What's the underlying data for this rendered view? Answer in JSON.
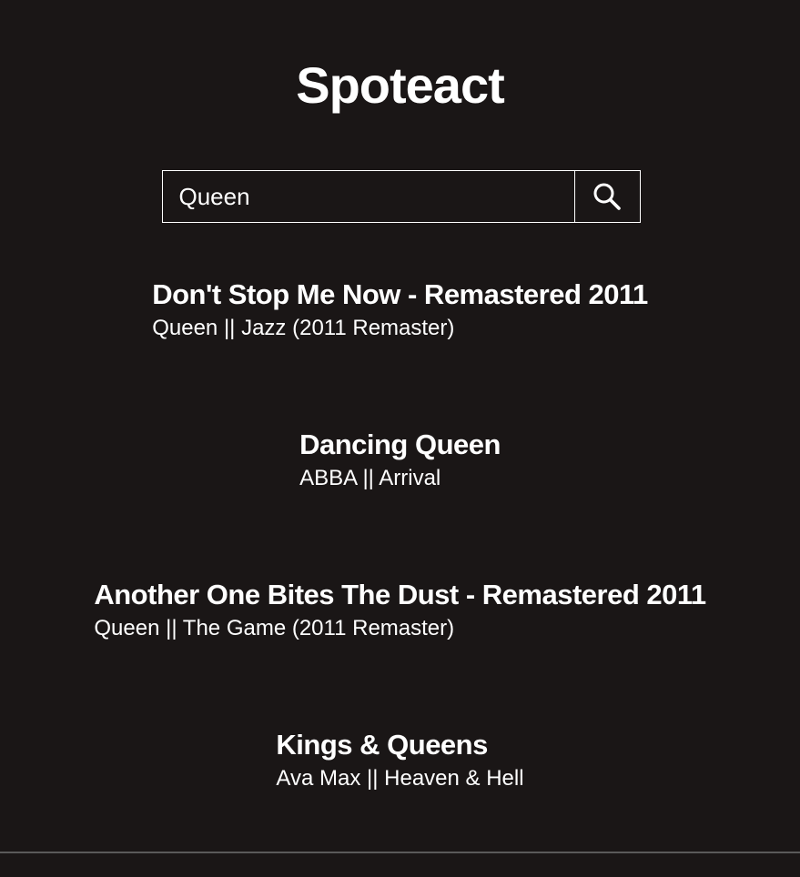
{
  "app": {
    "title": "Spoteact"
  },
  "search": {
    "value": "Queen",
    "icon": "search-icon"
  },
  "results": [
    {
      "title": "Don't Stop Me Now - Remastered 2011",
      "subtitle": "Queen || Jazz (2011 Remaster)"
    },
    {
      "title": "Dancing Queen",
      "subtitle": "ABBA || Arrival"
    },
    {
      "title": "Another One Bites The Dust - Remastered 2011",
      "subtitle": "Queen || The Game (2011 Remaster)"
    },
    {
      "title": "Kings & Queens",
      "subtitle": "Ava Max || Heaven & Hell"
    }
  ],
  "colors": {
    "background": "#1a1616",
    "text": "#ffffff"
  }
}
